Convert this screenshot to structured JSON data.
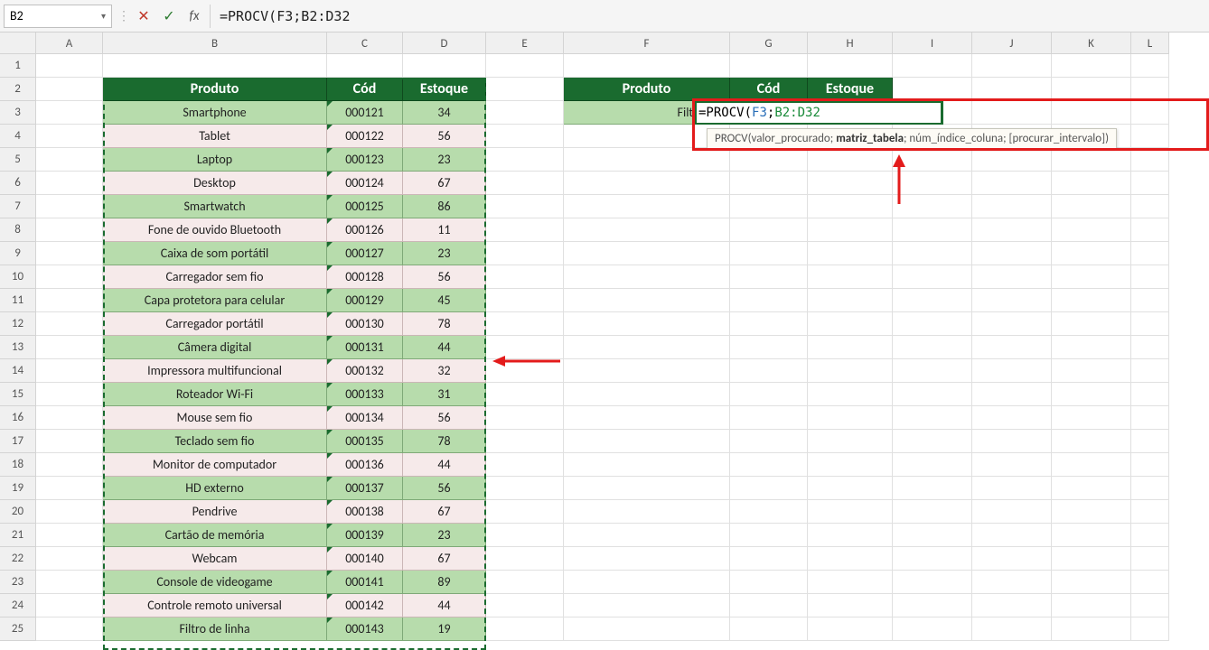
{
  "name_box": "B2",
  "formula_bar": "=PROCV(F3;B2:D32",
  "columns": [
    "A",
    "B",
    "C",
    "D",
    "E",
    "F",
    "G",
    "H",
    "I",
    "J",
    "K",
    "L"
  ],
  "row_count": 25,
  "table1": {
    "headers": [
      "Produto",
      "Cód",
      "Estoque"
    ],
    "rows": [
      {
        "p": "Smartphone",
        "c": "000121",
        "e": "34"
      },
      {
        "p": "Tablet",
        "c": "000122",
        "e": "56"
      },
      {
        "p": "Laptop",
        "c": "000123",
        "e": "23"
      },
      {
        "p": "Desktop",
        "c": "000124",
        "e": "67"
      },
      {
        "p": "Smartwatch",
        "c": "000125",
        "e": "86"
      },
      {
        "p": "Fone de ouvido Bluetooth",
        "c": "000126",
        "e": "11"
      },
      {
        "p": "Caixa de som portátil",
        "c": "000127",
        "e": "23"
      },
      {
        "p": "Carregador sem fio",
        "c": "000128",
        "e": "56"
      },
      {
        "p": "Capa protetora para celular",
        "c": "000129",
        "e": "45"
      },
      {
        "p": "Carregador portátil",
        "c": "000130",
        "e": "78"
      },
      {
        "p": "Câmera digital",
        "c": "000131",
        "e": "44"
      },
      {
        "p": "Impressora multifuncional",
        "c": "000132",
        "e": "32"
      },
      {
        "p": "Roteador Wi-Fi",
        "c": "000133",
        "e": "31"
      },
      {
        "p": "Mouse sem fio",
        "c": "000134",
        "e": "56"
      },
      {
        "p": "Teclado sem fio",
        "c": "000135",
        "e": "78"
      },
      {
        "p": "Monitor de computador",
        "c": "000136",
        "e": "44"
      },
      {
        "p": "HD externo",
        "c": "000137",
        "e": "56"
      },
      {
        "p": "Pendrive",
        "c": "000138",
        "e": "67"
      },
      {
        "p": "Cartão de memória",
        "c": "000139",
        "e": "23"
      },
      {
        "p": "Webcam",
        "c": "000140",
        "e": "67"
      },
      {
        "p": "Console de videogame",
        "c": "000141",
        "e": "89"
      },
      {
        "p": "Controle remoto universal",
        "c": "000142",
        "e": "44"
      },
      {
        "p": "Filtro de linha",
        "c": "000143",
        "e": "19"
      }
    ]
  },
  "table2": {
    "headers": [
      "Produto",
      "Cód",
      "Estoque"
    ],
    "f3_value": "Filtro de l"
  },
  "active_formula": {
    "prefix": "=PROCV(",
    "ref1": "F3",
    "sep": ";",
    "ref2": "B2:D32"
  },
  "tooltip": {
    "fn": "PROCV",
    "p1": "valor_procurado",
    "p2": "matriz_tabela",
    "p3": "núm_índice_coluna",
    "p4": "[procurar_intervalo]"
  }
}
